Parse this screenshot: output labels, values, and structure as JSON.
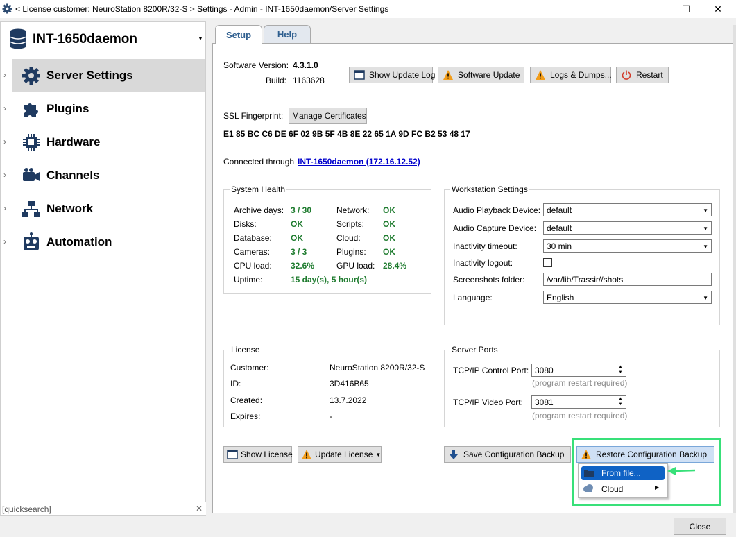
{
  "window": {
    "title": "< License customer: NeuroStation 8200R/32-S > Settings - Admin - INT-1650daemon/Server Settings",
    "minimize": "—",
    "maximize": "☐",
    "close": "✕"
  },
  "sidebar": {
    "server_name": "INT-1650daemon",
    "items": [
      {
        "label": "Server Settings",
        "icon": "gear-icon"
      },
      {
        "label": "Plugins",
        "icon": "puzzle-icon"
      },
      {
        "label": "Hardware",
        "icon": "chip-icon"
      },
      {
        "label": "Channels",
        "icon": "camera-icon"
      },
      {
        "label": "Network",
        "icon": "network-icon"
      },
      {
        "label": "Automation",
        "icon": "robot-icon"
      }
    ],
    "quicksearch_placeholder": "[quicksearch]",
    "quicksearch_clear": "✕"
  },
  "tabs": [
    {
      "label": "Setup",
      "active": true
    },
    {
      "label": "Help",
      "active": false
    }
  ],
  "setup": {
    "software_version_label": "Software Version:",
    "software_version": "4.3.1.0",
    "build_label": "Build:",
    "build": "1163628",
    "buttons": {
      "show_update_log": "Show Update Log",
      "software_update": "Software Update",
      "logs_dumps": "Logs & Dumps...",
      "restart": "Restart"
    },
    "ssl_label": "SSL Fingerprint:",
    "manage_certificates": "Manage Certificates",
    "ssl_fingerprint": "E1 85 BC C6 DE 6F 02 9B 5F 4B 8E 22 65 1A 9D FC B2 53 48 17",
    "connected_label": "Connected through",
    "connected_link": "INT-1650daemon (172.16.12.52)"
  },
  "system_health": {
    "title": "System Health",
    "left": [
      {
        "label": "Archive days:",
        "value": "3 / 30"
      },
      {
        "label": "Disks:",
        "value": "OK"
      },
      {
        "label": "Database:",
        "value": "OK"
      },
      {
        "label": "Cameras:",
        "value": "3 / 3"
      },
      {
        "label": "CPU load:",
        "value": "32.6%"
      },
      {
        "label": "Uptime:",
        "value": "15 day(s), 5 hour(s)"
      }
    ],
    "right": [
      {
        "label": "Network:",
        "value": "OK"
      },
      {
        "label": "Scripts:",
        "value": "OK"
      },
      {
        "label": "Cloud:",
        "value": "OK"
      },
      {
        "label": "Plugins:",
        "value": "OK"
      },
      {
        "label": "GPU load:",
        "value": "28.4%"
      }
    ]
  },
  "workstation": {
    "title": "Workstation Settings",
    "audio_playback_label": "Audio Playback Device:",
    "audio_playback_value": "default",
    "audio_capture_label": "Audio Capture Device:",
    "audio_capture_value": "default",
    "inactivity_timeout_label": "Inactivity timeout:",
    "inactivity_timeout_value": "30 min",
    "inactivity_logout_label": "Inactivity logout:",
    "inactivity_logout_checked": false,
    "screenshots_label": "Screenshots folder:",
    "screenshots_value": "/var/lib/Trassir//shots",
    "language_label": "Language:",
    "language_value": "English"
  },
  "license": {
    "title": "License",
    "rows": [
      {
        "label": "Customer:",
        "value": "NeuroStation 8200R/32-S"
      },
      {
        "label": "ID:",
        "value": "3D416B65"
      },
      {
        "label": "Created:",
        "value": "13.7.2022"
      },
      {
        "label": "Expires:",
        "value": "-"
      }
    ],
    "show_license": "Show License",
    "update_license": "Update License"
  },
  "ports": {
    "title": "Server Ports",
    "control_label": "TCP/IP Control Port:",
    "control_value": "3080",
    "video_label": "TCP/IP Video Port:",
    "video_value": "3081",
    "restart_hint": "(program restart required)"
  },
  "backup": {
    "save": "Save Configuration Backup",
    "restore": "Restore Configuration Backup",
    "menu": [
      {
        "label": "From file...",
        "highlighted": true
      },
      {
        "label": "Cloud",
        "has_submenu": true
      }
    ]
  },
  "footer": {
    "close": "Close"
  },
  "colors": {
    "ok_green": "#1e7b2e",
    "highlight_outline": "#38e079",
    "menu_selection": "#0f62c5",
    "link_blue": "#0000cc",
    "icon_dark_blue": "#1f3a60",
    "warning_orange": "#f29d1a"
  }
}
